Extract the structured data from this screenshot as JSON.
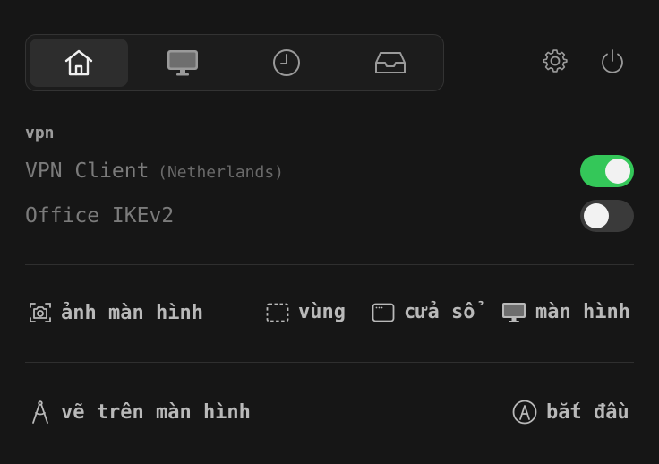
{
  "tabs": [
    {
      "icon": "home-icon",
      "active": true
    },
    {
      "icon": "monitor-icon",
      "active": false
    },
    {
      "icon": "clock-icon",
      "active": false
    },
    {
      "icon": "inbox-icon",
      "active": false
    }
  ],
  "header": {
    "settings_icon": "gear-icon",
    "power_icon": "power-icon"
  },
  "vpn": {
    "label": "vpn",
    "items": [
      {
        "name": "VPN Client",
        "location": "(Netherlands)",
        "enabled": true
      },
      {
        "name": "Office IKEv2",
        "location": "",
        "enabled": false
      }
    ]
  },
  "screenshot": {
    "label": "ảnh màn hình",
    "options": [
      {
        "label": "vùng",
        "icon": "region-icon"
      },
      {
        "label": "cửa sổ",
        "icon": "window-icon"
      },
      {
        "label": "màn hình",
        "icon": "display-icon"
      }
    ]
  },
  "draw": {
    "label": "vẽ trên màn hình",
    "start_label": "bắt đầu"
  },
  "colors": {
    "toggle_on": "#34c759",
    "toggle_off": "#3a3a3a",
    "background": "#161616"
  }
}
